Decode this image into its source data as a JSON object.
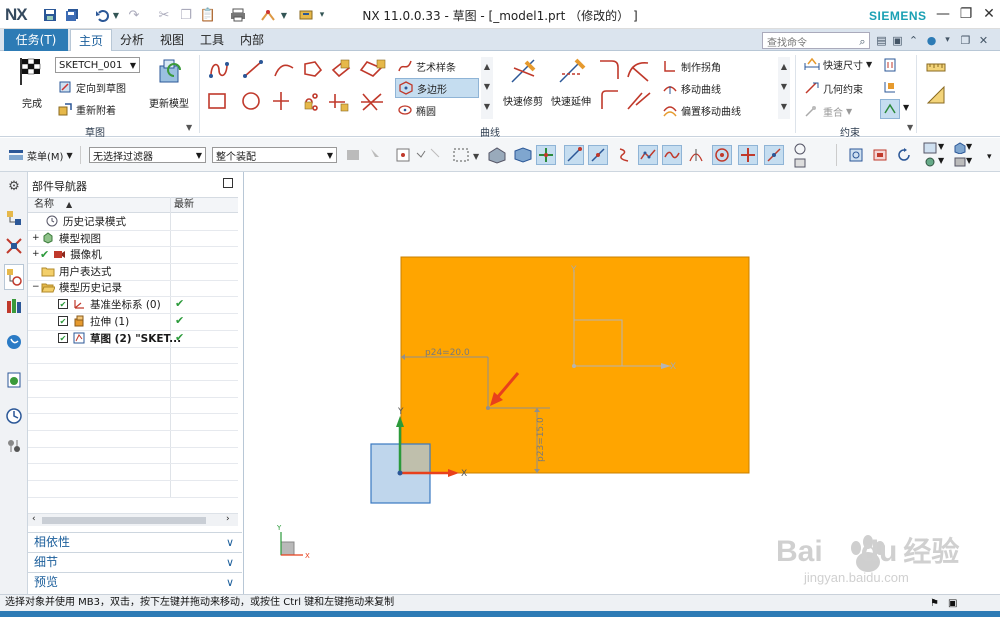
{
  "titlebar": {
    "logo": "NX",
    "title": "NX 11.0.0.33 - 草图 - [_model1.prt （修改的） ]",
    "brand": "SIEMENS"
  },
  "menubar": {
    "task": "任务(T)",
    "tabs": [
      "主页",
      "分析",
      "视图",
      "工具",
      "内部"
    ],
    "search_placeholder": "查找命令"
  },
  "ribbon": {
    "sketch_group": {
      "finish": "完成",
      "sketch_name": "SKETCH_001",
      "orient": "定向到草图",
      "reattach": "重新附着",
      "update_model": "更新模型",
      "label": "草图"
    },
    "curve_group": {
      "art_spline": "艺术样条",
      "polygon": "多边形",
      "ellipse": "椭圆",
      "quick_trim": "快速修剪",
      "quick_extend": "快速延伸",
      "make_corner": "制作拐角",
      "move_curve": "移动曲线",
      "offset_move_curve": "偏置移动曲线",
      "label": "曲线"
    },
    "constraint_group": {
      "rapid_dim": "快速尺寸",
      "geo_constraint": "几何约束",
      "coincide": "重合",
      "label": "约束"
    }
  },
  "toolbar2": {
    "menu": "菜单(M)",
    "filter": "无选择过滤器",
    "assembly": "整个装配"
  },
  "navigator": {
    "title": "部件导航器",
    "col_name": "名称",
    "col_latest": "最新",
    "rows": [
      {
        "label": "历史记录模式",
        "indent": 0,
        "check": ""
      },
      {
        "label": "模型视图",
        "indent": 0,
        "check": ""
      },
      {
        "label": "摄像机",
        "indent": 0,
        "check": ""
      },
      {
        "label": "用户表达式",
        "indent": 0,
        "check": ""
      },
      {
        "label": "模型历史记录",
        "indent": 0,
        "check": ""
      },
      {
        "label": "基准坐标系 (0)",
        "indent": 1,
        "check": "✔"
      },
      {
        "label": "拉伸 (1)",
        "indent": 1,
        "check": "✔"
      },
      {
        "label": "草图 (2) \"SKET...",
        "indent": 1,
        "check": "✔"
      }
    ],
    "sections": [
      "相依性",
      "细节",
      "预览"
    ]
  },
  "graphics": {
    "dim_horizontal": "p24=20.0",
    "dim_vertical": "p23=15.0",
    "axis_x": "X",
    "axis_y": "Y",
    "colors": {
      "body": "#ffa500",
      "sketch_line": "#9a9a9a",
      "arrow": "#e8401c"
    }
  },
  "statusbar": {
    "text": "选择对象并使用 MB3，双击，按下左键并拖动来移动，或按住 Ctrl 键和左键拖动来复制"
  },
  "watermark": {
    "brand": "Bai",
    "brand2": "du",
    "cn": "经验",
    "url": "jingyan.baidu.com"
  }
}
